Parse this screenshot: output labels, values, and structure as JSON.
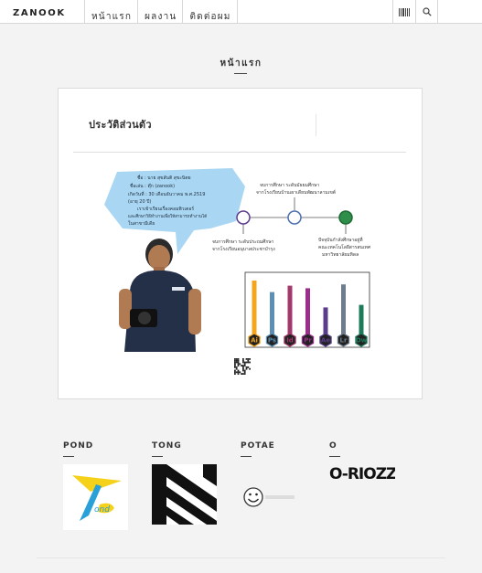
{
  "header": {
    "logo": "ZANOOK",
    "nav": [
      "หน้าแรก",
      "ผลงาน",
      "ติดต่อผม"
    ],
    "tools": [
      "barcode-icon",
      "search-icon"
    ]
  },
  "page": {
    "title": "หน้าแรก"
  },
  "card": {
    "title": "ประวัติส่วนตัว",
    "bubble_lines": [
      "ชื่อ : นาย สุขสันติ สุขะนิตย",
      "ชื่อเล่น : ตุ๊ก (zanook)",
      "เกิดวันที่ : 30 เดือนธันวาคม พ.ศ.2519",
      "(อายุ 20 ปี)",
      "เราเข้าเรียนเรื่องคอมพิวเตอร์",
      "และศึกษาวิธีทำงานเพื่อให้สามารถทำงานได้",
      "ในสาขามีเดีย"
    ],
    "timeline": {
      "top_caption": [
        "จบการศึกษา ระดับมัธยมศึกษา",
        "จากโรงเรียนบ้านเผาเดียนพัฒนาลามเขต์"
      ],
      "bottom_left_caption": [
        "จบการศึกษา ระดับประถมศึกษา",
        "จากโรงเรียนอนุบาลประชาบำรุง"
      ],
      "bottom_right_caption": [
        "ปัจจุบันกำลังศึกษาอยู่ที่",
        "คณะเทคโนโลยีสารสนเทศ",
        "มหาวิทยาลัยมหิดล"
      ]
    },
    "skills": [
      {
        "label": "Ai",
        "value": 90,
        "color": "#f4a51c"
      },
      {
        "label": "Ps",
        "value": 72,
        "color": "#5b8fb4"
      },
      {
        "label": "Id",
        "value": 82,
        "color": "#a3386b"
      },
      {
        "label": "Pr",
        "value": 78,
        "color": "#9b2d8b"
      },
      {
        "label": "Ae",
        "value": 48,
        "color": "#5a3d8c"
      },
      {
        "label": "Lr",
        "value": 84,
        "color": "#6e7d8e"
      },
      {
        "label": "Dw",
        "value": 52,
        "color": "#1e7b5a"
      }
    ]
  },
  "profiles": [
    {
      "name": "POND"
    },
    {
      "name": "TONG"
    },
    {
      "name": "POTAE"
    },
    {
      "name": "O",
      "logo_text": "O-RIOZZ"
    }
  ]
}
